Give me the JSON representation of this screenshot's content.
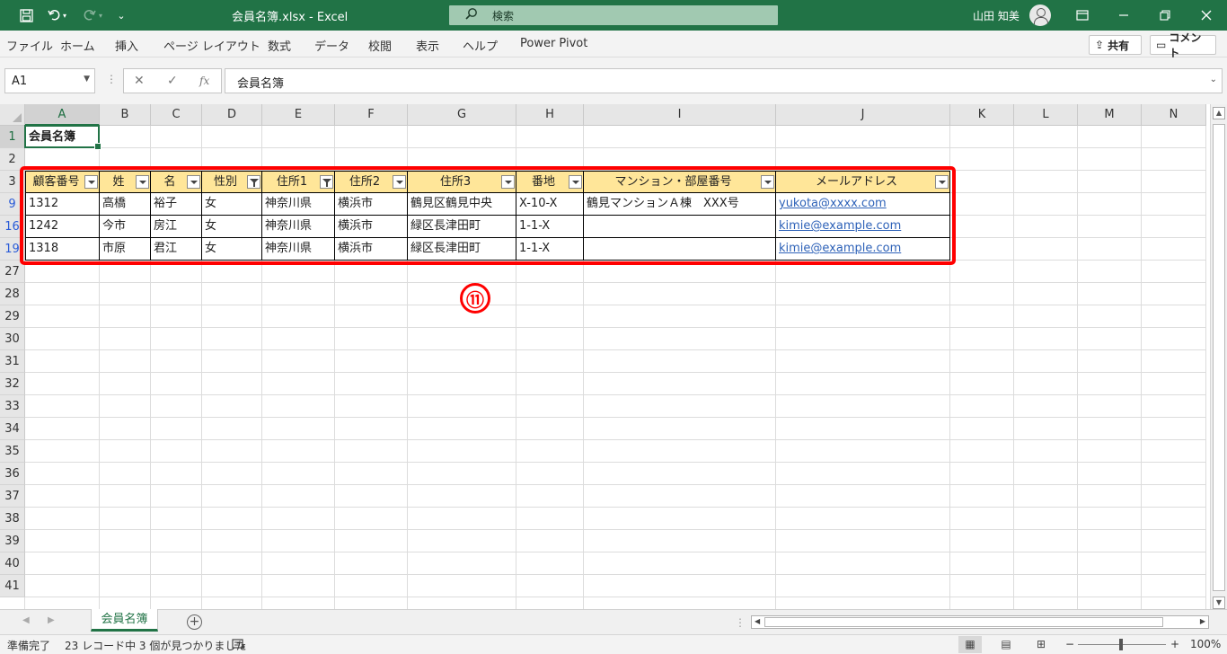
{
  "window": {
    "title": "会員名簿.xlsx  -  Excel",
    "search_placeholder": "検索",
    "user_name": "山田 知美",
    "search_icon": "search-icon"
  },
  "menu": {
    "items": [
      "ファイル",
      "ホーム",
      "挿入",
      "ページ レイアウト",
      "数式",
      "データ",
      "校閲",
      "表示",
      "ヘルプ",
      "Power Pivot"
    ],
    "share_label": "共有",
    "comment_label": "コメント"
  },
  "formula_bar": {
    "name_box": "A1",
    "fx_label": "fx",
    "content": "会員名簿"
  },
  "columns": [
    "A",
    "B",
    "C",
    "D",
    "E",
    "F",
    "G",
    "H",
    "I",
    "J",
    "K",
    "L",
    "M",
    "N"
  ],
  "rows": [
    "1",
    "2",
    "3",
    "9",
    "16",
    "19",
    "27",
    "28",
    "29",
    "30",
    "31",
    "32",
    "33",
    "34",
    "35",
    "36",
    "37",
    "38",
    "39",
    "40",
    "41"
  ],
  "sheet": {
    "a1": "会員名簿",
    "table_headers": [
      "顧客番号",
      "姓",
      "名",
      "性別",
      "住所1",
      "住所2",
      "住所3",
      "番地",
      "マンション・部屋番号",
      "メールアドレス"
    ],
    "filtered_columns": [
      3,
      4
    ],
    "table_rows": [
      [
        "1312",
        "高橋",
        "裕子",
        "女",
        "神奈川県",
        "横浜市",
        "鶴見区鶴見中央",
        "X-10-X",
        "鶴見マンションＡ棟　XXX号",
        "yukota@xxxx.com"
      ],
      [
        "1242",
        "今市",
        "房江",
        "女",
        "神奈川県",
        "横浜市",
        "緑区長津田町",
        "1-1-X",
        "",
        "kimie@example.com"
      ],
      [
        "1318",
        "市原",
        "君江",
        "女",
        "神奈川県",
        "横浜市",
        "緑区長津田町",
        "1-1-X",
        "",
        "kimie@example.com"
      ]
    ]
  },
  "annotation": {
    "marker": "⑪",
    "color": "#ff0000"
  },
  "tabs": {
    "sheet_name": "会員名簿",
    "add_label": "+"
  },
  "status": {
    "ready": "準備完了",
    "record_info": "23 レコード中 3 個が見つかりました",
    "zoom": "100%"
  },
  "colors": {
    "accent": "#217346",
    "table_header": "#ffe699",
    "link": "#2e62b8"
  }
}
